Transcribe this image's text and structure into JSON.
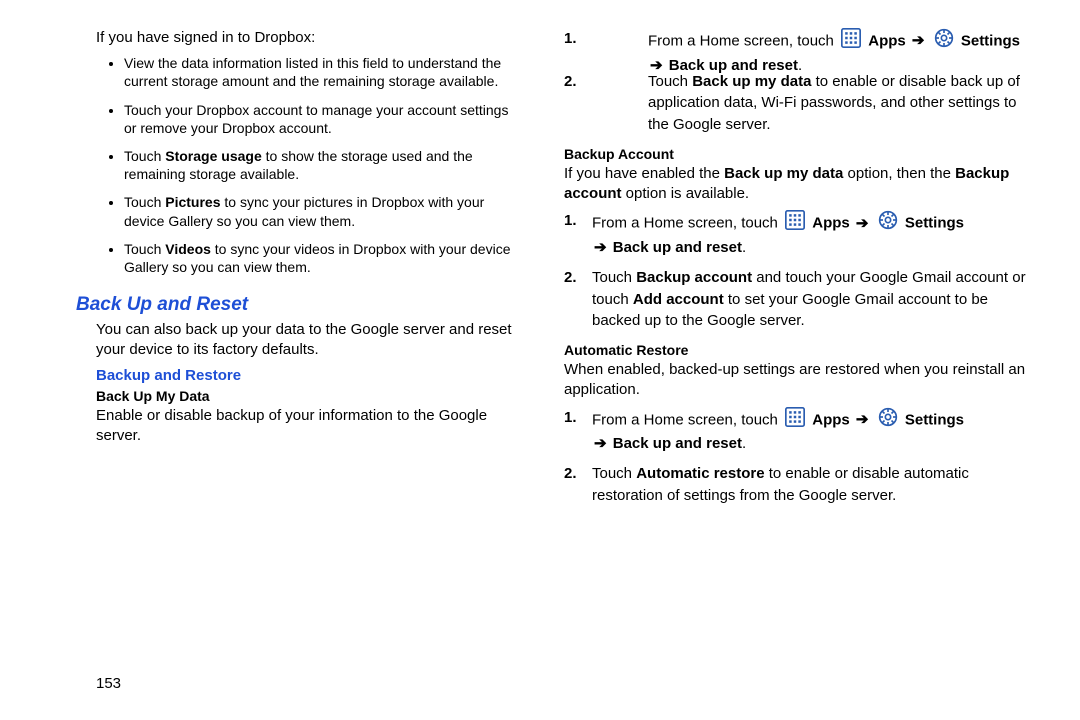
{
  "page_number": "153",
  "intro": "If you have signed in to Dropbox:",
  "bullets": {
    "b1": "View the data information listed in this field to understand the current storage amount and the remaining storage available.",
    "b2": "Touch your Dropbox account to manage your account settings or remove your Dropbox account.",
    "b3_pre": "Touch ",
    "b3_bold": "Storage usage",
    "b3_post": " to  show the storage used and the remaining storage available.",
    "b4_pre": "Touch ",
    "b4_bold": "Pictures",
    "b4_post": " to sync your pictures in Dropbox with your device Gallery so you can view them.",
    "b5_pre": "Touch ",
    "b5_bold": "Videos",
    "b5_post": " to sync your videos in Dropbox with your device Gallery so you can view them."
  },
  "section_title": "Back Up and Reset",
  "section_desc": "You can also back up your data to the Google server and reset your device to its factory defaults.",
  "subsection_title": "Backup and Restore",
  "mini1": "Back Up My Data",
  "mini1_desc": "Enable or disable backup of your information to the Google server.",
  "nav": {
    "from_home": "From a Home screen, touch ",
    "apps": "Apps",
    "arrow": "➔",
    "settings": "Settings",
    "tail": "Back up and reset",
    "period": "."
  },
  "step2a_pre": "Touch ",
  "step2a_bold": "Back up my data",
  "step2a_post": " to enable or disable back up of application data, Wi-Fi passwords, and other settings to the Google server.",
  "backup_account_hdr": "Backup Account",
  "backup_account_txt_pre": "If you have enabled the ",
  "backup_account_txt_bold1": "Back up my data",
  "backup_account_txt_mid": " option, then the ",
  "backup_account_txt_bold2": "Backup account",
  "backup_account_txt_post": " option is available.",
  "step2b_pre": "Touch ",
  "step2b_b1": "Backup account",
  "step2b_mid": " and touch your Google Gmail account or touch ",
  "step2b_b2": "Add account",
  "step2b_post": " to set your Google Gmail account to be backed up to the Google server.",
  "auto_restore_hdr": "Automatic Restore",
  "auto_restore_txt": "When enabled, backed-up settings are restored when you reinstall an application.",
  "step2c_pre": "Touch ",
  "step2c_bold": "Automatic restore",
  "step2c_post": " to enable or disable automatic restoration of settings from the Google server."
}
